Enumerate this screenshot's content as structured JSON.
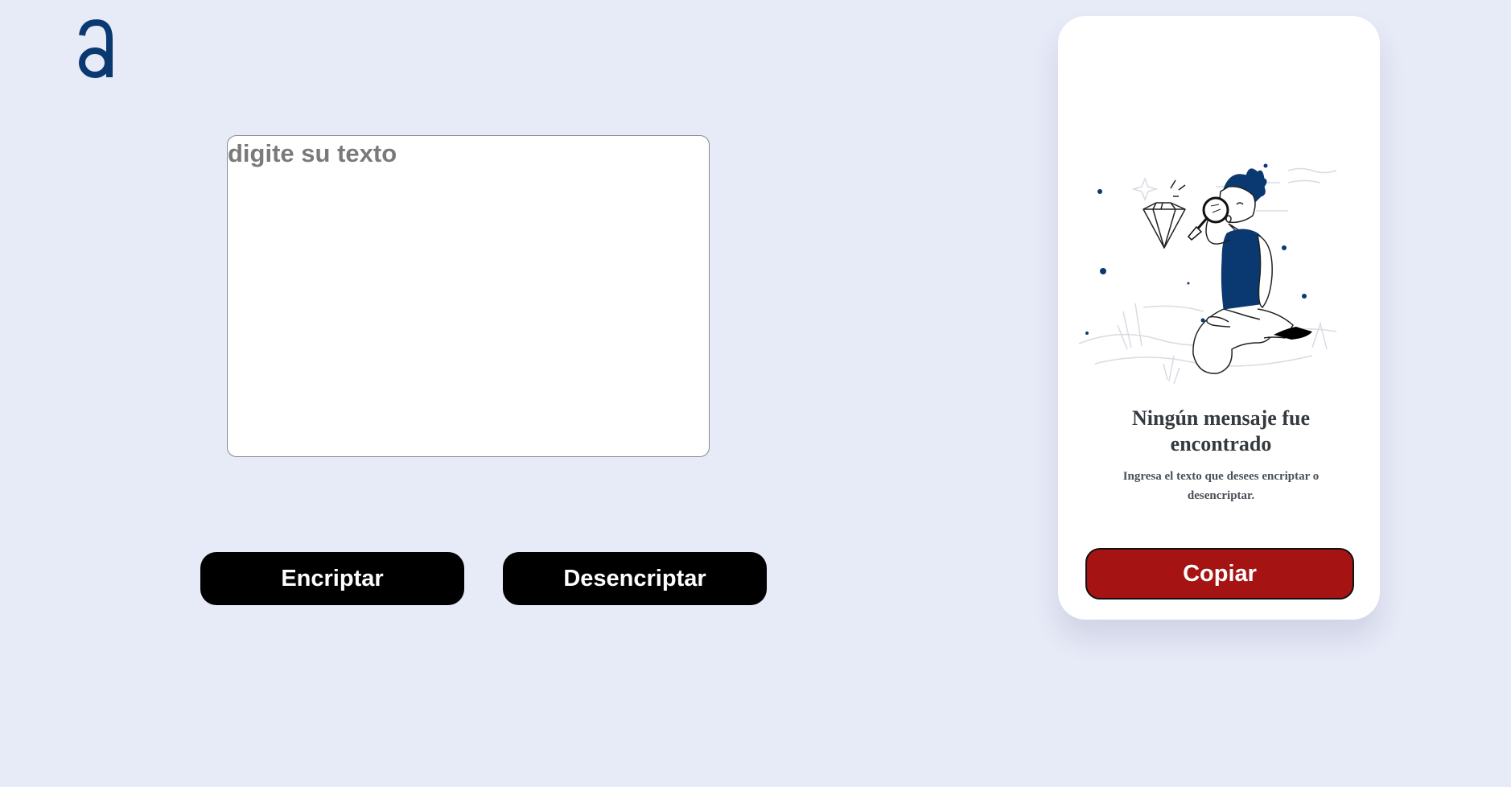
{
  "colors": {
    "background": "#e7eaf7",
    "brand": "#0a3871",
    "button_dark": "#000000",
    "button_copy": "#a51313",
    "card": "#ffffff"
  },
  "header": {
    "logo_icon": "alura-a-logo-icon"
  },
  "editor": {
    "placeholder": "digite su texto",
    "value": ""
  },
  "actions": {
    "encrypt_label": "Encriptar",
    "decrypt_label": "Desencriptar"
  },
  "result_panel": {
    "illustration_icon": "person-magnifying-glass-diamond-icon",
    "title": "Ningún mensaje fue encontrado",
    "description": "Ingresa el texto que desees encriptar o desencriptar.",
    "copy_label": "Copiar"
  }
}
